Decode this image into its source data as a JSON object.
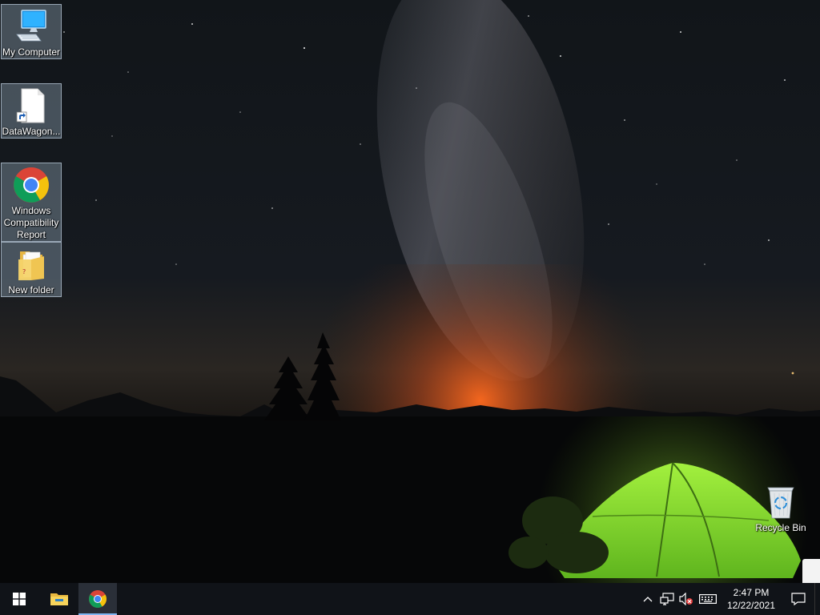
{
  "desktop": {
    "icons": [
      {
        "label": "My Computer",
        "icon": "monitor-icon"
      },
      {
        "label": "DataWagon...",
        "icon": "shortcut-file-icon"
      },
      {
        "label": "Windows Compatibility Report",
        "icon": "chrome-icon"
      },
      {
        "label": "New folder",
        "icon": "folder-icon"
      }
    ],
    "recycle_bin": {
      "label": "Recycle Bin",
      "icon": "recycle-bin-icon"
    }
  },
  "taskbar": {
    "start": {
      "icon": "windows-logo-icon"
    },
    "pinned": [
      {
        "icon": "file-explorer-icon",
        "active": false
      },
      {
        "icon": "chrome-icon",
        "active": true
      }
    ],
    "tray": {
      "icons": [
        "chevron-up-icon",
        "network-icon",
        "volume-muted-icon",
        "keyboard-icon"
      ],
      "time": "2:47 PM",
      "date": "12/22/2021",
      "notification_icon": "action-center-icon"
    }
  },
  "colors": {
    "taskbar_bg": "#101318",
    "tent_green": "#7fd42a",
    "horizon_glow": "#e0602a",
    "selection": "#cde8ff"
  }
}
